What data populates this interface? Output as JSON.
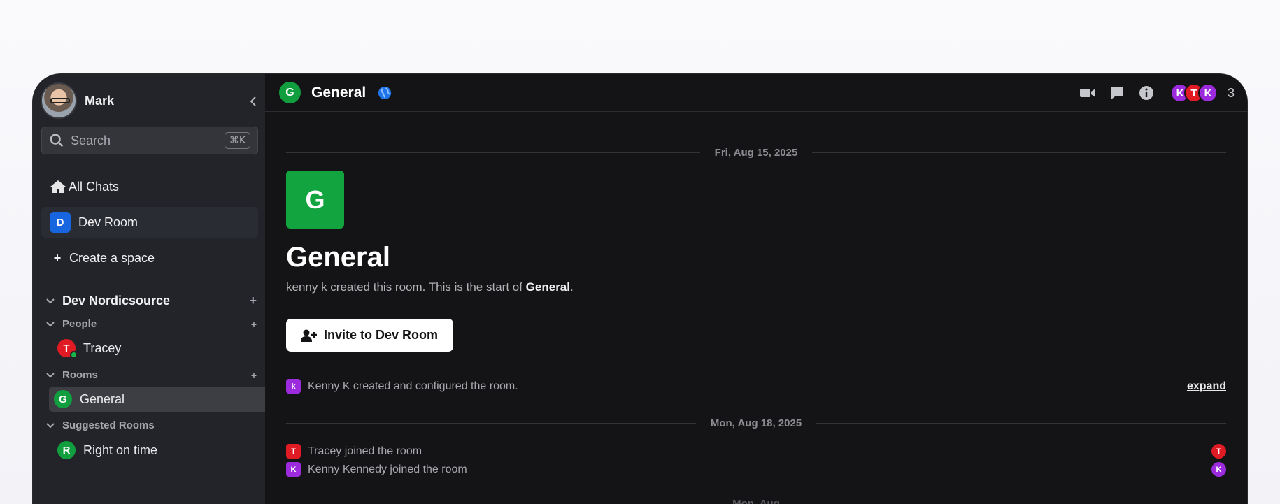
{
  "user": {
    "name": "Mark"
  },
  "search": {
    "placeholder": "Search",
    "shortcut": "⌘K"
  },
  "nav": {
    "all_chats": "All Chats",
    "space": {
      "badge": "D",
      "label": "Dev Room",
      "color": "#1766e0"
    },
    "create_space": "Create a space"
  },
  "sections": {
    "space_name": "Dev Nordicsource",
    "people": {
      "label": "People",
      "items": [
        {
          "initial": "T",
          "name": "Tracey",
          "color": "#e01b24"
        }
      ]
    },
    "rooms": {
      "label": "Rooms",
      "items": [
        {
          "initial": "G",
          "name": "General",
          "color": "#119e3e"
        }
      ]
    },
    "suggested": {
      "label": "Suggested Rooms",
      "items": [
        {
          "initial": "R",
          "name": "Right on time",
          "color": "#119e3e"
        }
      ]
    }
  },
  "room": {
    "initial": "G",
    "name": "General",
    "member_avatars": [
      {
        "initial": "K",
        "color": "#9b2bdd"
      },
      {
        "initial": "T",
        "color": "#e01b24"
      },
      {
        "initial": "K",
        "color": "#9b2bdd"
      }
    ],
    "member_count": "3"
  },
  "timeline": {
    "date1": "Fri, Aug 15, 2025",
    "intro_title": "General",
    "intro_prefix": "kenny k created this room. This is the start of ",
    "intro_room": "General",
    "intro_suffix": ".",
    "invite_label": "Invite to Dev Room",
    "event1": {
      "initial": "k",
      "text": "Kenny K created and configured the room.",
      "color": "#9b2bdd"
    },
    "expand_label": "expand",
    "date2": "Mon, Aug 18, 2025",
    "event2": {
      "initial": "T",
      "text": "Tracey joined the room",
      "color": "#e01b24"
    },
    "event3": {
      "initial": "K",
      "text": "Kenny Kennedy joined the room",
      "color": "#9b2bdd"
    },
    "partial_date": "Mon, Aug"
  }
}
